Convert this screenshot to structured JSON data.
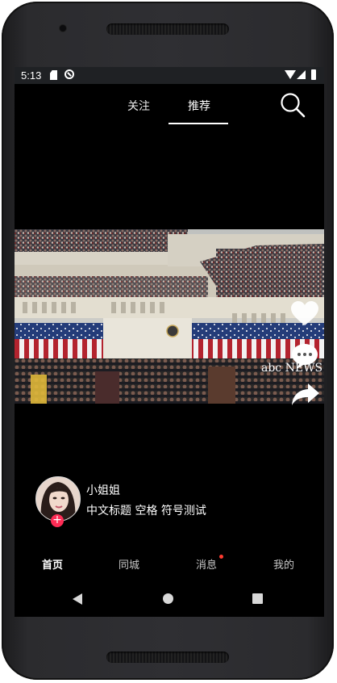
{
  "status_bar": {
    "time": "5:13",
    "icons": [
      "sd-card-icon",
      "do-not-disturb-icon",
      "wifi-icon",
      "signal-icon",
      "battery-icon"
    ]
  },
  "top_tabs": [
    {
      "label": "关注",
      "active": false
    },
    {
      "label": "推荐",
      "active": true
    }
  ],
  "search": {
    "icon": "search-icon"
  },
  "video": {
    "watermark": "abc NEWS"
  },
  "side_actions": [
    {
      "icon": "heart-icon"
    },
    {
      "icon": "comment-icon"
    },
    {
      "icon": "share-icon"
    }
  ],
  "author": {
    "name": "小姐姐",
    "follow_symbol": "+"
  },
  "video_title": "中文标题 空格 符号测试",
  "bottom_nav": [
    {
      "label": "首页",
      "active": true
    },
    {
      "label": "同城",
      "active": false
    },
    {
      "label": "消息",
      "active": false,
      "badge": true
    },
    {
      "label": "我的",
      "active": false
    }
  ],
  "colors": {
    "accent": "#fe2c55",
    "badge": "#ff3b30",
    "background": "#000000"
  }
}
